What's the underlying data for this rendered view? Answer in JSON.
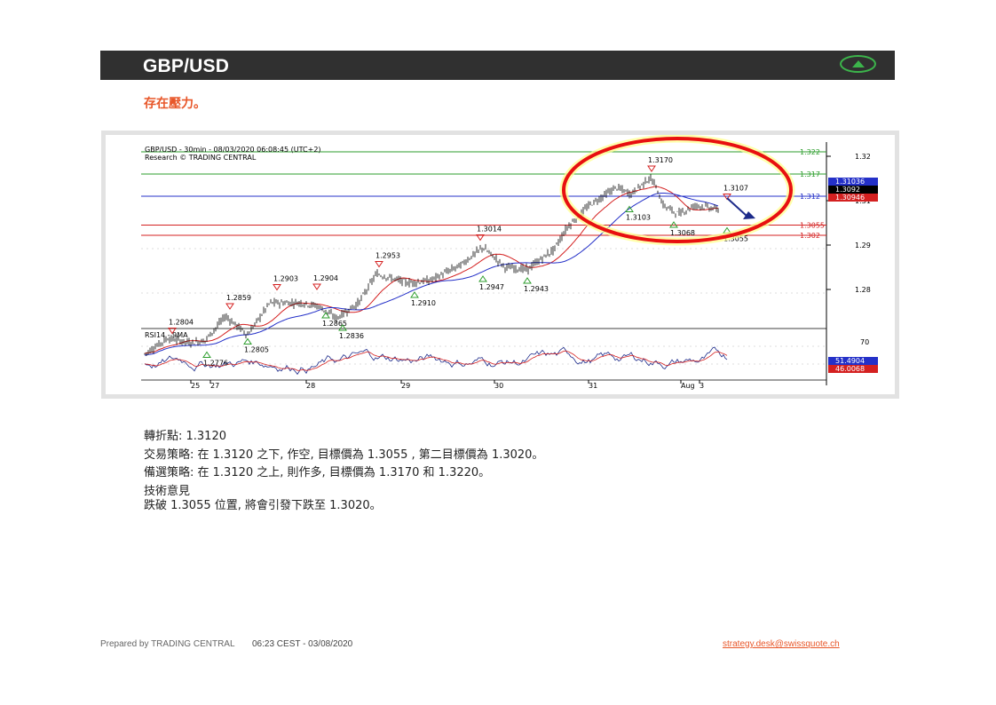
{
  "header": {
    "title": "GBP/USD",
    "direction_icon": "up-arrow-icon",
    "accent_color": "#3cb44b"
  },
  "subtitle": "存在壓力。",
  "chart": {
    "title": "GBP/USD - 30min - 08/03/2020 06:08:45 (UTC+2)",
    "research": "Research © TRADING CENTRAL",
    "indicator_label": "RSI14 - 9MA",
    "price_axis": [
      "1.32",
      "1.31",
      "1.29",
      "1.28"
    ],
    "rsi_axis": [
      "70"
    ],
    "x_ticks": [
      "25",
      "27",
      "28",
      "29",
      "30",
      "31",
      "Aug",
      "3"
    ],
    "levels": [
      {
        "label": "1.322",
        "color": "#2e9e2e",
        "price": 1.322
      },
      {
        "label": "1.317",
        "color": "#2e9e2e",
        "price": 1.317
      },
      {
        "label": "1.312",
        "color": "#2430c8",
        "price": 1.312
      },
      {
        "label": "1.3055",
        "color": "#d42020",
        "price": 1.3055
      },
      {
        "label": "1.302",
        "color": "#d42020",
        "price": 1.3032
      }
    ],
    "price_tags": [
      {
        "label": "1.31036",
        "bg": "#2430c8",
        "fg": "#ffffff"
      },
      {
        "label": "1.3092",
        "bg": "#000000",
        "fg": "#ffffff"
      },
      {
        "label": "1.30946",
        "bg": "#d42020",
        "fg": "#ffffff"
      }
    ],
    "rsi_tags": [
      {
        "label": "51.4904",
        "bg": "#2430c8",
        "fg": "#ffffff"
      },
      {
        "label": "46.0068",
        "bg": "#d42020",
        "fg": "#ffffff"
      }
    ],
    "highs": [
      {
        "label": "1.2804"
      },
      {
        "label": "1.2859"
      },
      {
        "label": "1.2903"
      },
      {
        "label": "1.2904"
      },
      {
        "label": "1.2953"
      },
      {
        "label": "1.3014"
      },
      {
        "label": "1.3170"
      },
      {
        "label": "1.3107"
      }
    ],
    "lows": [
      {
        "label": "1.2776"
      },
      {
        "label": "1.2805"
      },
      {
        "label": "1.2865"
      },
      {
        "label": "1.2836"
      },
      {
        "label": "1.2910"
      },
      {
        "label": "1.2947"
      },
      {
        "label": "1.2943"
      },
      {
        "label": "1.3103"
      },
      {
        "label": "1.3068"
      },
      {
        "label": "1.3055"
      }
    ],
    "colors": {
      "highlight_ellipse": "#e81010",
      "forecast_arrow": "#1c2a8a"
    }
  },
  "analysis": {
    "pivot": "轉折點: 1.3120",
    "strategy": "交易策略: 在 1.3120 之下, 作空, 目標價為 1.3055 , 第二目標價為 1.3020。",
    "alternative": "備選策略: 在 1.3120 之上, 則作多, 目標價為 1.3170 和 1.3220。",
    "opinion_title": "技術意見",
    "opinion": "跌破 1.3055 位置, 將會引發下跌至 1.3020。"
  },
  "footer": {
    "prepared_by": "Prepared by TRADING CENTRAL",
    "timestamp": "06:23 CEST - 03/08/2020",
    "email": "strategy.desk@swissquote.ch"
  }
}
